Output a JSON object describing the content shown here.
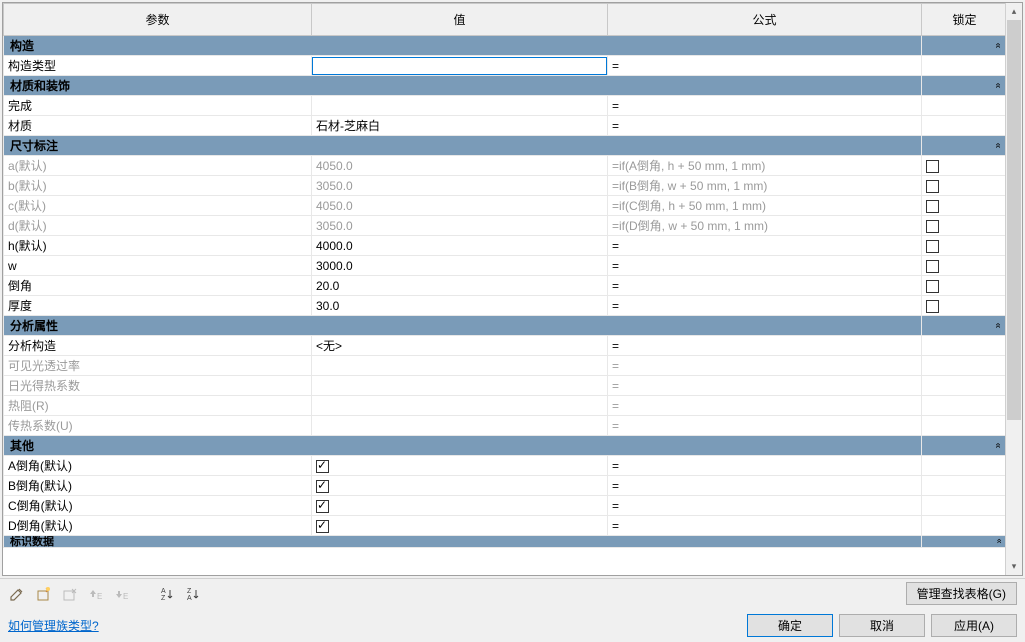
{
  "columns": {
    "param": "参数",
    "value": "值",
    "formula": "公式",
    "lock": "锁定"
  },
  "groups": [
    {
      "name": "构造",
      "rows": [
        {
          "param": "构造类型",
          "value": "",
          "formula": "=",
          "lock": null,
          "selected": true
        }
      ]
    },
    {
      "name": "材质和装饰",
      "rows": [
        {
          "param": "完成",
          "value": "",
          "formula": "=",
          "lock": null
        },
        {
          "param": "材质",
          "value": "石材-芝麻白",
          "formula": "=",
          "lock": null
        }
      ]
    },
    {
      "name": "尺寸标注",
      "rows": [
        {
          "param": "a(默认)",
          "value": "4050.0",
          "formula": "=if(A倒角, h + 50 mm, 1 mm)",
          "lock": false,
          "disabled": true
        },
        {
          "param": "b(默认)",
          "value": "3050.0",
          "formula": "=if(B倒角, w + 50 mm, 1 mm)",
          "lock": false,
          "disabled": true
        },
        {
          "param": "c(默认)",
          "value": "4050.0",
          "formula": "=if(C倒角, h + 50 mm, 1 mm)",
          "lock": false,
          "disabled": true
        },
        {
          "param": "d(默认)",
          "value": "3050.0",
          "formula": "=if(D倒角, w + 50 mm, 1 mm)",
          "lock": false,
          "disabled": true
        },
        {
          "param": "h(默认)",
          "value": "4000.0",
          "formula": "=",
          "lock": false
        },
        {
          "param": "w",
          "value": "3000.0",
          "formula": "=",
          "lock": false
        },
        {
          "param": "倒角",
          "value": "20.0",
          "formula": "=",
          "lock": false
        },
        {
          "param": "厚度",
          "value": "30.0",
          "formula": "=",
          "lock": false
        }
      ]
    },
    {
      "name": "分析属性",
      "rows": [
        {
          "param": "分析构造",
          "value": "<无>",
          "formula": "=",
          "lock": null
        },
        {
          "param": "可见光透过率",
          "value": "",
          "formula": "=",
          "lock": null,
          "disabled": true
        },
        {
          "param": "日光得热系数",
          "value": "",
          "formula": "=",
          "lock": null,
          "disabled": true
        },
        {
          "param": "热阻(R)",
          "value": "",
          "formula": "=",
          "lock": null,
          "disabled": true
        },
        {
          "param": "传热系数(U)",
          "value": "",
          "formula": "=",
          "lock": null,
          "disabled": true
        }
      ]
    },
    {
      "name": "其他",
      "rows": [
        {
          "param": "A倒角(默认)",
          "value_check": true,
          "formula": "=",
          "lock": null
        },
        {
          "param": "B倒角(默认)",
          "value_check": true,
          "formula": "=",
          "lock": null
        },
        {
          "param": "C倒角(默认)",
          "value_check": true,
          "formula": "=",
          "lock": null
        },
        {
          "param": "D倒角(默认)",
          "value_check": true,
          "formula": "=",
          "lock": null
        }
      ]
    }
  ],
  "cutoff_group": "标识数据",
  "buttons": {
    "manage_lookup": "管理查找表格(G)",
    "ok": "确定",
    "cancel": "取消",
    "apply": "应用(A)"
  },
  "footer": {
    "help_link": "如何管理族类型?"
  },
  "caret": "»"
}
